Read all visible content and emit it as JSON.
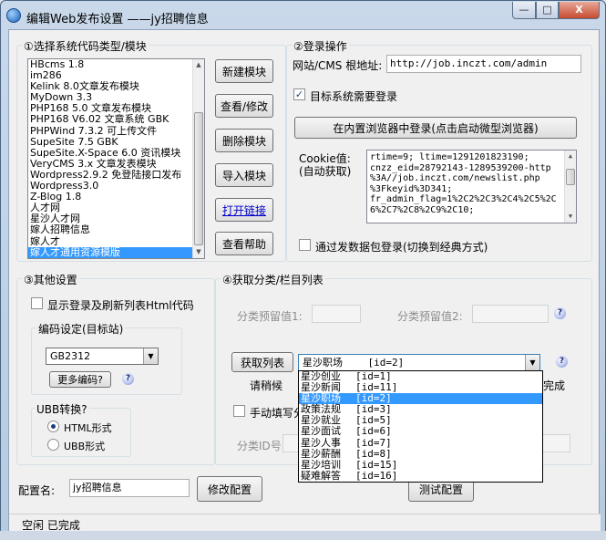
{
  "window": {
    "title": "编辑Web发布设置 ——jy招聘信息",
    "min_label": "—",
    "max_label": "□",
    "close_label": "X"
  },
  "section1": {
    "label": "①选择系统代码类型/模块",
    "systems": [
      "HBcms 1.8",
      "im286",
      "Kelink 8.0文章发布模块",
      "MyDown 3.3",
      "PHP168 5.0 文章发布模块",
      "PHP168 V6.02 文章系统 GBK",
      "PHPWind 7.3.2 可上传文件",
      "SupeSite 7.5 GBK",
      "SupeSite.X-Space 6.0 资讯模块",
      "VeryCMS 3.x 文章发表模块",
      "Wordpress2.9.2 免登陆接口发布",
      "Wordpress3.0",
      "Z-Blog 1.8",
      "人才网",
      "星沙人才网",
      "嫁人招聘信息",
      "嫁人才",
      "嫁人才通用资源模版"
    ],
    "selected_index": 17,
    "buttons": {
      "new": "新建模块",
      "view": "查看/修改",
      "delete": "删除模块",
      "import": "导入模块",
      "open_link": "打开链接",
      "help": "查看帮助"
    }
  },
  "section2": {
    "label": "②登录操作",
    "url_label": "网站/CMS 根地址:",
    "url_value": "http://job.inczt.com/admin",
    "need_login_label": "目标系统需要登录",
    "need_login_checked": true,
    "browser_login_button": "在内置浏览器中登录(点击启动微型浏览器)",
    "cookie_label": "Cookie值:",
    "cookie_sublabel": "(自动获取)",
    "cookie_lines": [
      "rtime=9; ltime=1291201823190;",
      "cnzz_eid=28792143-1289539200-http",
      "%3A//job.inczt.com/newslist.php",
      "%3Fkeyid%3D341;",
      "fr_admin_flag=1%2C2%2C3%2C4%2C5%2C",
      "6%2C7%2C8%2C9%2C10;"
    ],
    "packet_login_label": "通过发数据包登录(切换到经典方式)",
    "packet_login_checked": false
  },
  "section3": {
    "label": "③其他设置",
    "show_login_label": "显示登录及刷新列表Html代码",
    "show_login_checked": false,
    "encoding_label": "编码设定(目标站)",
    "encoding_value": "GB2312",
    "more_encoding_button": "更多编码?",
    "ubb_label": "UBB转换?",
    "html_label": "HTML形式",
    "ubb_option_label": "UBB形式",
    "selected_format": "HTML"
  },
  "section4": {
    "label": "④获取分类/栏目列表",
    "reserve1_label": "分类预留值1:",
    "reserve2_label": "分类预留值2:",
    "get_list_button": "获取列表",
    "selected_category": "星沙职场",
    "selected_id": "[id=2]",
    "wait_text": "请稍候",
    "done_text": "完成",
    "manual_label": "手动填写分",
    "category_id_label": "分类ID号:",
    "dropdown": [
      {
        "name": "星沙创业",
        "id": "[id=1]"
      },
      {
        "name": "星沙新闻",
        "id": "[id=11]"
      },
      {
        "name": "星沙职场",
        "id": "[id=2]"
      },
      {
        "name": "政策法规",
        "id": "[id=3]"
      },
      {
        "name": "星沙就业",
        "id": "[id=5]"
      },
      {
        "name": "星沙面试",
        "id": "[id=6]"
      },
      {
        "name": "星沙人事",
        "id": "[id=7]"
      },
      {
        "name": "星沙薪酬",
        "id": "[id=8]"
      },
      {
        "name": "星沙培训",
        "id": "[id=15]"
      },
      {
        "name": "疑难解答",
        "id": "[id=16]"
      }
    ],
    "dropdown_selected_index": 2
  },
  "footer": {
    "config_name_label": "配置名:",
    "config_name_value": "jy招聘信息",
    "modify_button": "修改配置",
    "test_button": "测试配置",
    "status_text": "空闲 已完成"
  },
  "icons": {
    "app": "globe-icon",
    "help": "help-question-icon",
    "dropdown": "chevron-down-icon"
  },
  "colors": {
    "selection": "#3399ff",
    "link": "#0000cc",
    "close": "#c64b30"
  }
}
